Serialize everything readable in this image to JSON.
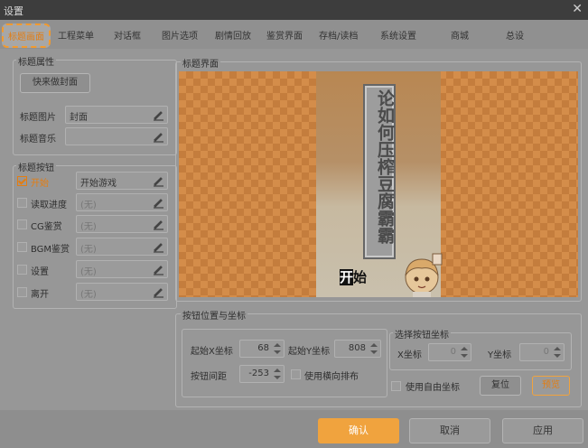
{
  "window": {
    "title": "设置"
  },
  "tabs": [
    {
      "label": "标题画面"
    },
    {
      "label": "工程菜单"
    },
    {
      "label": "对话框"
    },
    {
      "label": "图片选项"
    },
    {
      "label": "剧情回放"
    },
    {
      "label": "鉴赏界面"
    },
    {
      "label": "存档/读档"
    },
    {
      "label": "系统设置"
    },
    {
      "label": "商城"
    },
    {
      "label": "总设"
    }
  ],
  "title_props": {
    "legend": "标题属性",
    "quick_cover_label": "快来做封面",
    "image_label": "标题图片",
    "image_value": "封面",
    "music_label": "标题音乐",
    "music_value": ""
  },
  "title_buttons": {
    "legend": "标题按钮",
    "items": [
      {
        "label": "开始",
        "value": "开始游戏",
        "checked": true
      },
      {
        "label": "读取进度",
        "value": "(无)",
        "checked": false
      },
      {
        "label": "CG鉴赏",
        "value": "(无)",
        "checked": false
      },
      {
        "label": "BGM鉴赏",
        "value": "(无)",
        "checked": false
      },
      {
        "label": "设置",
        "value": "(无)",
        "checked": false
      },
      {
        "label": "离开",
        "value": "(无)",
        "checked": false
      }
    ]
  },
  "title_screen": {
    "legend": "标题界面",
    "game_title": "论如何压榨豆腐霸霸",
    "start_first": "开",
    "start_rest": "始"
  },
  "button_pos": {
    "legend": "按钮位置与坐标",
    "start_x_label": "起始X坐标",
    "start_x": "68",
    "start_y_label": "起始Y坐标",
    "start_y": "808",
    "spacing_label": "按钮间距",
    "spacing": "-253",
    "horizontal_label": "使用横向排布"
  },
  "select_coord": {
    "legend": "选择按钮坐标",
    "x_label": "X坐标",
    "x": "0",
    "y_label": "Y坐标",
    "y": "0",
    "free_label": "使用自由坐标",
    "reset_label": "复位",
    "preview_label": "预览"
  },
  "footer": {
    "confirm": "确认",
    "cancel": "取消",
    "apply": "应用"
  },
  "colors": {
    "accent": "#f0a33e",
    "accent_text": "#e37d12"
  },
  "icons": {
    "edit": "pencil-edit-icon",
    "close": "close-icon",
    "spinner": "spinner-arrows"
  }
}
